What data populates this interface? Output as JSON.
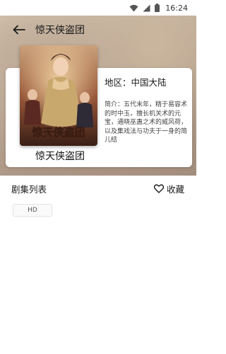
{
  "status_bar": {
    "time": "16:24",
    "icons": [
      "wifi-icon",
      "signal-icon",
      "battery-icon"
    ]
  },
  "header": {
    "title": "惊天侠盗团",
    "back_icon": "arrow-left-icon"
  },
  "detail": {
    "poster_title": "惊天侠盗团",
    "poster_caption": "惊天侠盗团",
    "region": "地区：中国大陆",
    "intro": "简介：五代末年，精于易容术的时中玉，擅长机关术的元宝，通晓巫蛊之术的威风荷，以及集戏法与功夫于一身的简儿结"
  },
  "episodes": {
    "section_title": "剧集列表",
    "favorite_label": "收藏",
    "favorite_icon": "heart-outline-icon",
    "items": [
      {
        "label": "HD"
      }
    ]
  },
  "colors": {
    "card_bg": "#ffffff",
    "text_primary": "#1a1a1a",
    "text_secondary": "#444444"
  }
}
